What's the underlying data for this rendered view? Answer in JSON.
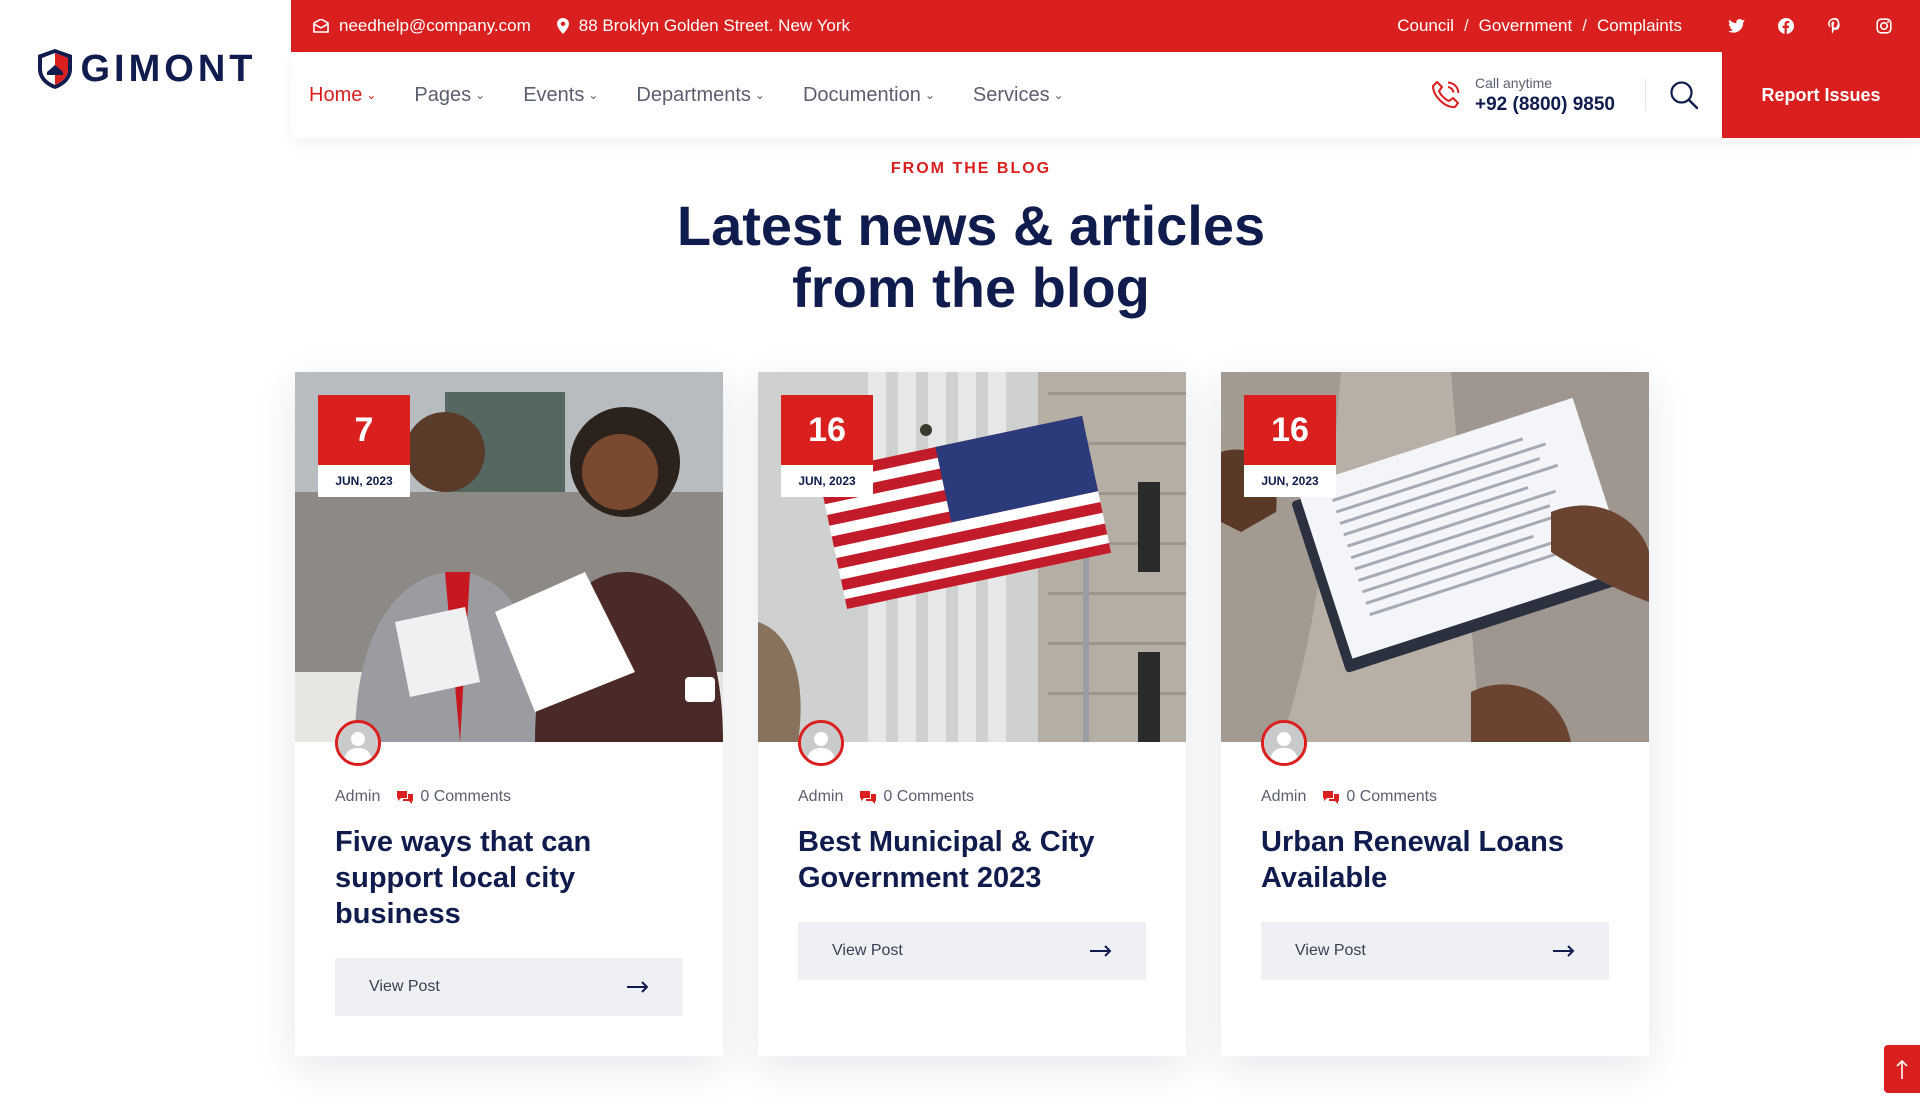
{
  "brand": {
    "name": "GIMONT"
  },
  "topbar": {
    "email": "needhelp@company.com",
    "address": "88 Broklyn Golden Street. New York",
    "links": [
      "Council",
      "Government",
      "Complaints"
    ],
    "link_separator": "/",
    "social_icons": [
      "twitter-icon",
      "facebook-icon",
      "pinterest-icon",
      "instagram-icon"
    ]
  },
  "nav": {
    "items": [
      {
        "label": "Home",
        "active": true
      },
      {
        "label": "Pages",
        "active": false
      },
      {
        "label": "Events",
        "active": false
      },
      {
        "label": "Departments",
        "active": false
      },
      {
        "label": "Documention",
        "active": false
      },
      {
        "label": "Services",
        "active": false
      }
    ],
    "call_label": "Call anytime",
    "call_number": "+92 (8800) 9850",
    "cta_label": "Report Issues"
  },
  "section": {
    "tagline": "FROM THE BLOG",
    "heading_line1": "Latest news & articles",
    "heading_line2": "from the blog"
  },
  "posts": [
    {
      "day": "7",
      "month": "JUN, 2023",
      "author": "Admin",
      "comments": "0 Comments",
      "title": "Five ways that can support local city business",
      "button": "View Post"
    },
    {
      "day": "16",
      "month": "JUN, 2023",
      "author": "Admin",
      "comments": "0 Comments",
      "title": "Best Municipal & City Government 2023",
      "button": "View Post"
    },
    {
      "day": "16",
      "month": "JUN, 2023",
      "author": "Admin",
      "comments": "0 Comments",
      "title": "Urban Renewal Loans Available",
      "button": "View Post"
    }
  ],
  "colors": {
    "accent": "#d9201e",
    "navy": "#0f1c4d",
    "muted": "#5b5f6e",
    "button_bg": "#eef0f4"
  }
}
